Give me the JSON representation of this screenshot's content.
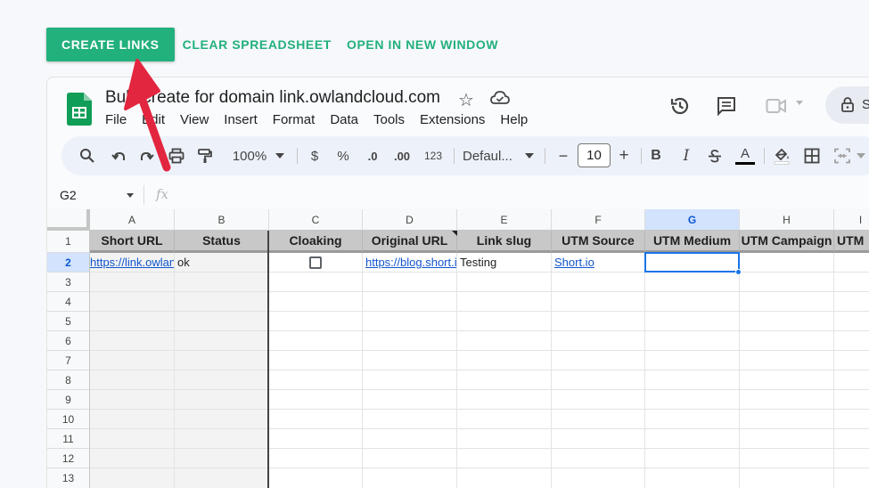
{
  "actions": {
    "create_links": "CREATE LINKS",
    "clear_spreadsheet": "CLEAR SPREADSHEET",
    "open_new_window": "OPEN IN NEW WINDOW"
  },
  "sheet": {
    "title": "Bulk create for domain link.owlandcloud.com",
    "menu": [
      "File",
      "Edit",
      "View",
      "Insert",
      "Format",
      "Data",
      "Tools",
      "Extensions",
      "Help"
    ],
    "share_label": "S"
  },
  "toolbar": {
    "zoom": "100%",
    "currency": "$",
    "percent": "%",
    "dec_decrease": ".0",
    "dec_increase": ".00",
    "number_format": "123",
    "font": "Defaul...",
    "font_size": "10",
    "minus": "−",
    "plus": "+",
    "bold": "B",
    "italic": "I",
    "text_color": "A"
  },
  "formula_bar": {
    "name_box": "G2",
    "fx": "fx"
  },
  "grid": {
    "columns": [
      "A",
      "B",
      "C",
      "D",
      "E",
      "F",
      "G",
      "H",
      "I"
    ],
    "selected_column": "G",
    "row_numbers": [
      "1",
      "2",
      "3",
      "4",
      "5",
      "6",
      "7",
      "8",
      "9",
      "10",
      "11",
      "12",
      "13"
    ],
    "selected_row": "2",
    "header_row": [
      "Short URL",
      "Status",
      "Cloaking",
      "Original URL",
      "Link slug",
      "UTM Source",
      "UTM Medium",
      "UTM Campaign",
      "UTM"
    ],
    "data_row": {
      "short_url": "https://link.owlandcloud.com",
      "status": "ok",
      "cloaking": false,
      "original_url": "https://blog.short.io",
      "link_slug": "Testing",
      "utm_source": "Short.io"
    }
  },
  "colors": {
    "brand_green": "#22b07d",
    "annotation_arrow": "#e3263f",
    "selection_blue": "#1a73e8"
  }
}
